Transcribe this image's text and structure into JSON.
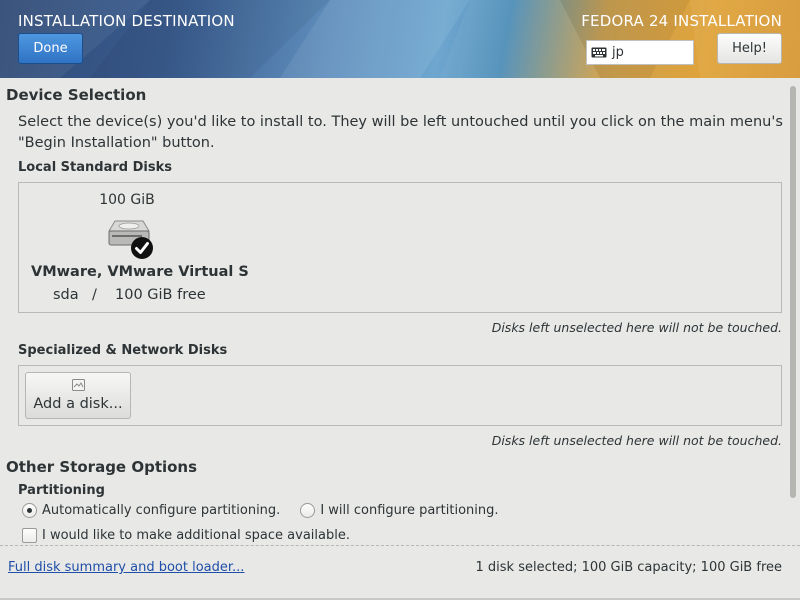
{
  "header": {
    "spoke_title": "INSTALLATION DESTINATION",
    "product_title": "FEDORA 24 INSTALLATION",
    "done_label": "Done",
    "help_label": "Help!",
    "keyboard_layout": "jp",
    "keyboard_icon": "keyboard-icon"
  },
  "device_selection": {
    "heading": "Device Selection",
    "instructions": "Select the device(s) you'd like to install to.  They will be left untouched until you click on the main menu's \"Begin Installation\" button.",
    "local_heading": "Local Standard Disks",
    "disks": [
      {
        "capacity": "100 GiB",
        "name": "VMware, VMware Virtual S",
        "device": "sda",
        "separator": "/",
        "free": "100 GiB free",
        "selected": true,
        "icon": "hard-disk-icon"
      }
    ],
    "local_note": "Disks left unselected here will not be touched.",
    "specialized_heading": "Specialized & Network Disks",
    "add_disk_label": "Add a disk...",
    "specialized_note": "Disks left unselected here will not be touched."
  },
  "other_storage": {
    "heading": "Other Storage Options",
    "partitioning_heading": "Partitioning",
    "auto_label": "Automatically configure partitioning.",
    "manual_label": "I will configure partitioning.",
    "selected_option": "auto",
    "reclaim_label": "I would like to make additional space available.",
    "reclaim_checked": false
  },
  "footer": {
    "summary_link": "Full disk summary and boot loader...",
    "status": "1 disk selected; 100 GiB capacity; 100 GiB free"
  },
  "colors": {
    "done_button": "#3a80d2",
    "link": "#1f4fa8",
    "background": "#e8e8e7"
  }
}
